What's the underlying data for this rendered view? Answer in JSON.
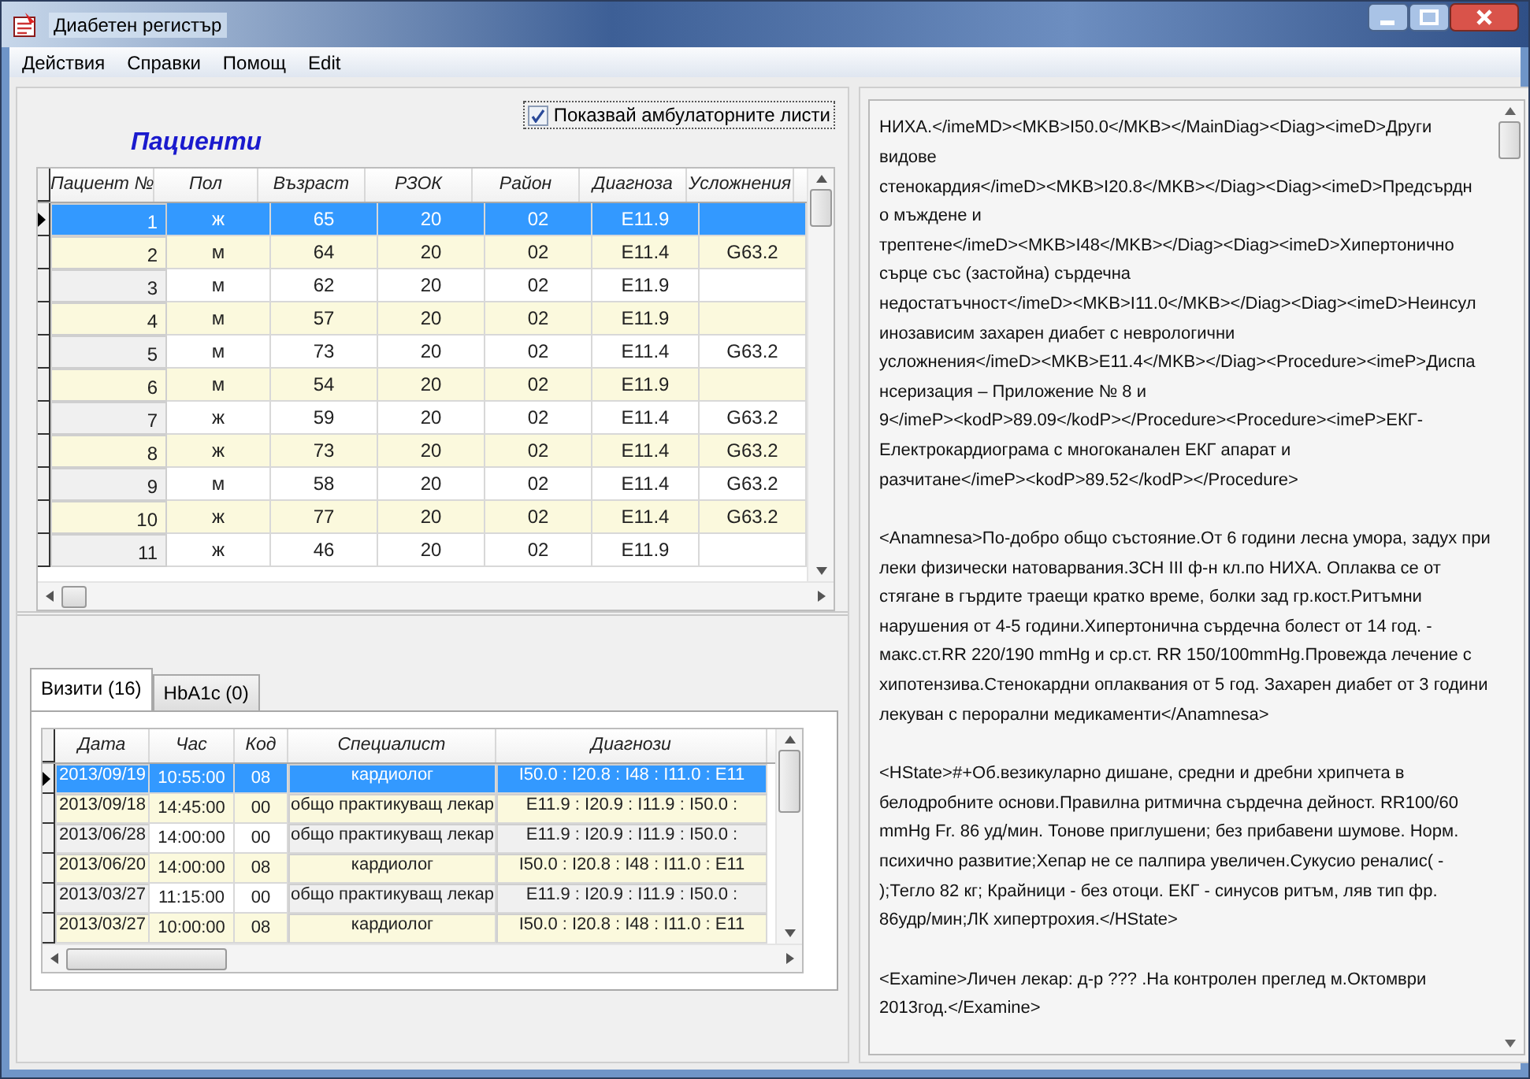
{
  "window": {
    "title": "Диабетен регистър"
  },
  "menu": [
    "Действия",
    "Справки",
    "Помощ",
    "Edit"
  ],
  "patients": {
    "title": "Пациенти",
    "show_sheets": {
      "label": "Показвай амбулаторните листи",
      "checked": true
    },
    "columns": [
      "Пациент №",
      "Пол",
      "Възраст",
      "РЗОК",
      "Район",
      "Диагноза",
      "Усложнения"
    ],
    "rows": [
      {
        "cells": [
          "1",
          "ж",
          "65",
          "20",
          "02",
          "E11.9",
          ""
        ],
        "selected": true
      },
      {
        "cells": [
          "2",
          "м",
          "64",
          "20",
          "02",
          "E11.4",
          "G63.2"
        ],
        "selected": false
      },
      {
        "cells": [
          "3",
          "м",
          "62",
          "20",
          "02",
          "E11.9",
          ""
        ],
        "selected": false
      },
      {
        "cells": [
          "4",
          "м",
          "57",
          "20",
          "02",
          "E11.9",
          ""
        ],
        "selected": false
      },
      {
        "cells": [
          "5",
          "м",
          "73",
          "20",
          "02",
          "E11.4",
          "G63.2"
        ],
        "selected": false
      },
      {
        "cells": [
          "6",
          "м",
          "54",
          "20",
          "02",
          "E11.9",
          ""
        ],
        "selected": false
      },
      {
        "cells": [
          "7",
          "ж",
          "59",
          "20",
          "02",
          "E11.4",
          "G63.2"
        ],
        "selected": false
      },
      {
        "cells": [
          "8",
          "ж",
          "73",
          "20",
          "02",
          "E11.4",
          "G63.2"
        ],
        "selected": false
      },
      {
        "cells": [
          "9",
          "м",
          "58",
          "20",
          "02",
          "E11.4",
          "G63.2"
        ],
        "selected": false
      },
      {
        "cells": [
          "10",
          "ж",
          "77",
          "20",
          "02",
          "E11.4",
          "G63.2"
        ],
        "selected": false
      },
      {
        "cells": [
          "11",
          "ж",
          "46",
          "20",
          "02",
          "E11.9",
          ""
        ],
        "selected": false
      }
    ]
  },
  "tabs": [
    {
      "label": "Визити (16)",
      "selected": true
    },
    {
      "label": "HbA1c (0)",
      "selected": false
    }
  ],
  "visits": {
    "columns": [
      "Дата",
      "Час",
      "Код",
      "Специалист",
      "Диагнози"
    ],
    "rows": [
      {
        "cells": [
          "2013/09/19",
          "10:55:00",
          "08",
          "кардиолог",
          "I50.0 : I20.8 : I48 : I11.0 : E11"
        ],
        "selected": true
      },
      {
        "cells": [
          "2013/09/18",
          "14:45:00",
          "00",
          "общо практикуващ лекар",
          "E11.9 : I20.9 : I11.9 : I50.0 :"
        ],
        "selected": false
      },
      {
        "cells": [
          "2013/06/28",
          "14:00:00",
          "00",
          "общо практикуващ лекар",
          "E11.9 : I20.9 : I11.9 : I50.0 :"
        ],
        "selected": false
      },
      {
        "cells": [
          "2013/06/20",
          "14:00:00",
          "08",
          "кардиолог",
          "I50.0 : I20.8 : I48 : I11.0 : E11"
        ],
        "selected": false
      },
      {
        "cells": [
          "2013/03/27",
          "11:15:00",
          "00",
          "общо практикуващ лекар",
          "E11.9 : I20.9 : I11.9 : I50.0 :"
        ],
        "selected": false
      },
      {
        "cells": [
          "2013/03/27",
          "10:00:00",
          "08",
          "кардиолог",
          "I50.0 : I20.8 : I48 : I11.0 : E11"
        ],
        "selected": false
      }
    ]
  },
  "document": {
    "paragraphs": [
      [
        "НИХА.</imeMD><MKB>I50.0</MKB></MainDiag><Diag><imeD>Други",
        "видове",
        "стенокардия</imeD><MKB>I20.8</MKB></Diag><Diag><imeD>Предсърдн",
        "о мъждене и",
        "трептене</imeD><MKB>I48</MKB></Diag><Diag><imeD>Хипертонично",
        "сърце със (застойна) сърдечна",
        "недостатъчност</imeD><MKB>I11.0</MKB></Diag><Diag><imeD>Неинсул",
        "инозависим захарен диабет с неврологични",
        "усложнения</imeD><MKB>E11.4</MKB></Diag><Procedure><imeP>Диспа",
        "нсеризация – Приложение № 8 и",
        "9</imeP><kodP>89.09</kodP></Procedure><Procedure><imeP>ЕКГ-",
        "Електрокардиограма с многоканален ЕКГ апарат и",
        "разчитане</imeP><kodP>89.52</kodP></Procedure>"
      ],
      [
        "<Anamnesa>По-добро общо състояние.От 6 години лесна умора, задух при",
        "леки физически натоварвания.ЗСН III ф-н кл.по НИХА. Оплаква се от",
        "стягане в гърдите траещи кратко време, болки зад гр.кост.Ритъмни",
        "нарушения от 4-5 години.Хипертонична сърдечна болест от 14 год. -",
        "макс.ст.RR 220/190 mmHg и ср.ст. RR 150/100mmHg.Провежда лечение с",
        "хипотензива.Стенокардни оплаквания от 5 год. Захарен диабет от 3 години",
        "лекуван с перорални медикаменти</Anamnesa>"
      ],
      [
        "<HState>#+Об.везикуларно дишане, средни и дребни хрипчета в",
        "белодробните основи.Правилна ритмична сърдечна дейност. RR100/60",
        "mmHg   Fr. 86 уд/мин. Тонове приглушени; без прибавени шумове. Норм.",
        "психично развитие;Хепар не се палпира увеличен.Сукусио реналис( -",
        ");Тегло 82 кг; Крайници - без отоци. ЕКГ - синусов ритъм, ляв тип фр.",
        "86удр/мин;ЛК хипертрохия.</HState>"
      ],
      [
        "<Examine>Личен лекар: д-р ??? .На контролен преглед м.Октомври",
        "2013год.</Examine>"
      ]
    ]
  }
}
